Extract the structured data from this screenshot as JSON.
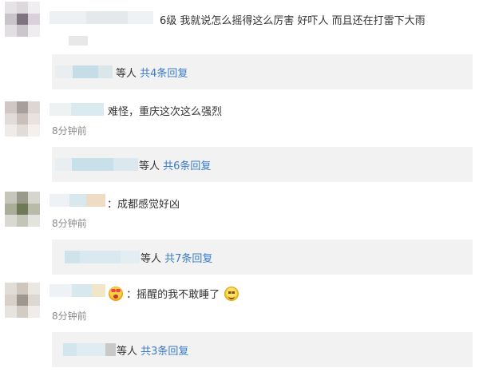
{
  "comments": [
    {
      "text": "6级 我就说怎么摇得这么厉害 好吓人 而且还在打雷下大雨",
      "time": "",
      "replies": {
        "etc": "等人",
        "count": "共4条回复"
      }
    },
    {
      "text": "难怪，重庆这次这么强烈",
      "time": "8分钟前",
      "replies": {
        "etc": "等人",
        "count": "共6条回复"
      }
    },
    {
      "text": "：成都感觉好凶",
      "time": "8分钟前",
      "replies": {
        "etc": "等人",
        "count": "共7条回复"
      }
    },
    {
      "text": "：摇醒的我不敢睡了",
      "time": "8分钟前",
      "icons": [
        "face-shock-emoji",
        "grin-emoji"
      ],
      "replies": {
        "etc": "等人",
        "count": "共3条回复"
      }
    }
  ],
  "colors": {
    "reply_bg": "#f2f2f2",
    "link": "#3a7bc8",
    "timestamp": "#8a8a8a"
  }
}
